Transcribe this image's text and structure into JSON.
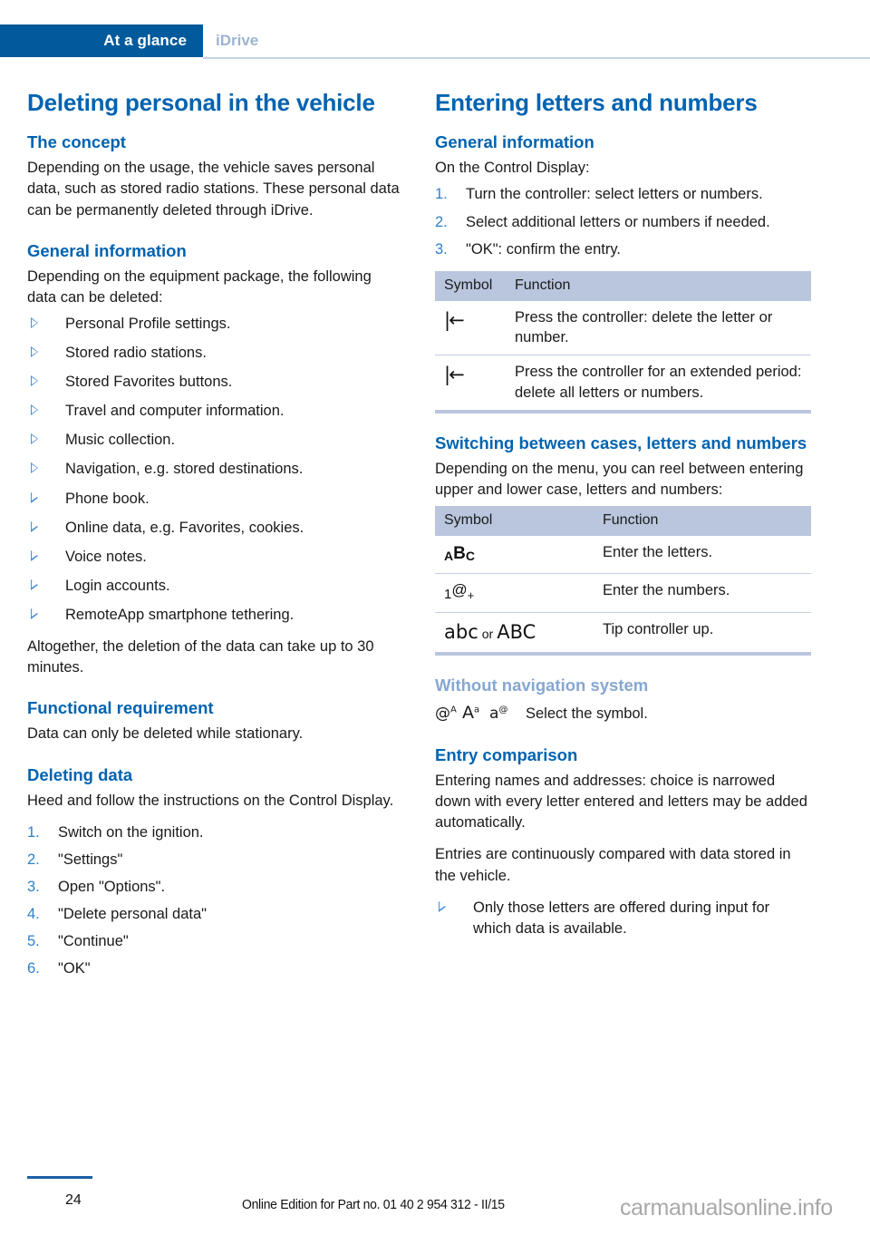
{
  "header": {
    "active_tab": "At a glance",
    "inactive_tab": "iDrive",
    "accent_color": "#005a9c"
  },
  "left_column": {
    "title": "Deleting personal in the vehicle",
    "sections": [
      {
        "heading": "The concept",
        "paragraphs": [
          "Depending on the usage, the vehicle saves personal data, such as stored radio stations. These personal data can be permanently deleted through iDrive."
        ]
      },
      {
        "heading": "General information",
        "intro": "Depending on the equipment package, the following data can be deleted:",
        "bullets": [
          "Personal Profile settings.",
          "Stored radio stations.",
          "Stored Favorites buttons.",
          "Travel and computer information.",
          "Music collection.",
          "Navigation, e.g. stored destinations.",
          "Phone book.",
          "Online data, e.g. Favorites, cookies.",
          "Voice notes.",
          "Login accounts.",
          "RemoteApp smartphone tethering."
        ],
        "outro": "Altogether, the deletion of the data can take up to 30 minutes."
      },
      {
        "heading": "Functional requirement",
        "paragraphs": [
          "Data can only be deleted while stationary."
        ]
      },
      {
        "heading": "Deleting data",
        "intro": "Heed and follow the instructions on the Control Display.",
        "steps": [
          "Switch on the ignition.",
          "\"Settings\"",
          "Open \"Options\".",
          "\"Delete personal data\"",
          "\"Continue\"",
          "\"OK\""
        ]
      }
    ]
  },
  "right_column": {
    "title": "Entering letters and numbers",
    "general_information": {
      "heading": "General information",
      "intro": "On the Control Display:",
      "steps": [
        "Turn the controller: select letters or numbers.",
        "Select additional letters or numbers if needed.",
        "\"OK\": confirm the entry."
      ]
    },
    "table1": {
      "columns": [
        "Symbol",
        "Function"
      ],
      "rows": [
        {
          "symbol": "backspace-icon",
          "function": "Press the controller: delete the letter or number."
        },
        {
          "symbol": "backspace-icon",
          "function": "Press the controller for an extended period: delete all letters or numbers."
        }
      ]
    },
    "switching": {
      "heading": "Switching between cases, letters and numbers",
      "intro": "Depending on the menu, you can reel between entering upper and lower case, letters and numbers:"
    },
    "table2": {
      "columns": [
        "Symbol",
        "Function"
      ],
      "rows": [
        {
          "symbol": "abc-letters-icon",
          "function": "Enter the letters."
        },
        {
          "symbol": "numbers-icon",
          "function": "Enter the numbers."
        },
        {
          "symbol": "case-toggle-icon",
          "function": "Tip controller up."
        }
      ]
    },
    "without_navigation": {
      "heading": "Without navigation system",
      "text": "Select the symbol."
    },
    "entry_comparison": {
      "heading": "Entry comparison",
      "paragraphs": [
        "Entering names and addresses: choice is narrowed down with every letter entered and letters may be added automatically.",
        "Entries are continuously compared with data stored in the vehicle."
      ],
      "bullets": [
        "Only those letters are offered during input for which data is available."
      ]
    }
  },
  "footer": {
    "page_number": "24",
    "note": "Online Edition for Part no. 01 40 2 954 312 - II/15",
    "watermark": "carmanualsonline.info"
  }
}
